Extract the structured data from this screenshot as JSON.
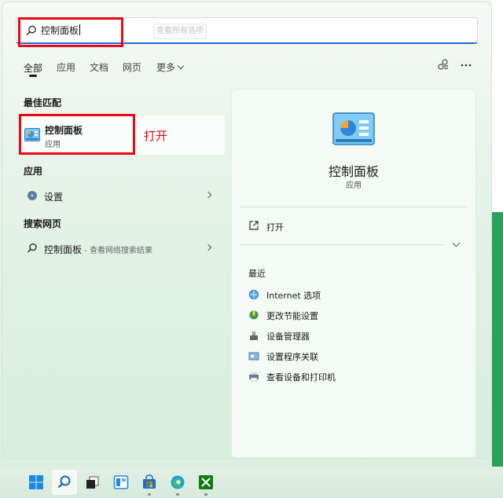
{
  "search": {
    "query": "控制面板",
    "ghost_button": "查看所有选项"
  },
  "tabs": [
    {
      "label": "全部"
    },
    {
      "label": "应用"
    },
    {
      "label": "文档"
    },
    {
      "label": "网页"
    },
    {
      "label": "更多"
    }
  ],
  "best_match": {
    "heading": "最佳匹配",
    "name": "控制面板",
    "type": "应用",
    "annotation": "打开"
  },
  "apps": {
    "heading": "应用",
    "items": [
      {
        "label": "设置"
      }
    ]
  },
  "web": {
    "heading": "搜索网页",
    "query": "控制面板",
    "suffix": " - 查看网络搜索结果"
  },
  "detail": {
    "title": "控制面板",
    "subtitle": "应用",
    "open_label": "打开",
    "recent_heading": "最近",
    "recent": [
      {
        "label": "Internet 选项",
        "icon": "internet-options-icon"
      },
      {
        "label": "更改节能设置",
        "icon": "power-settings-icon"
      },
      {
        "label": "设备管理器",
        "icon": "device-manager-icon"
      },
      {
        "label": "设置程序关联",
        "icon": "file-association-icon"
      },
      {
        "label": "查看设备和打印机",
        "icon": "printer-icon"
      }
    ]
  },
  "colors": {
    "accent": "#1f6fd1",
    "highlight": "#e50914"
  }
}
